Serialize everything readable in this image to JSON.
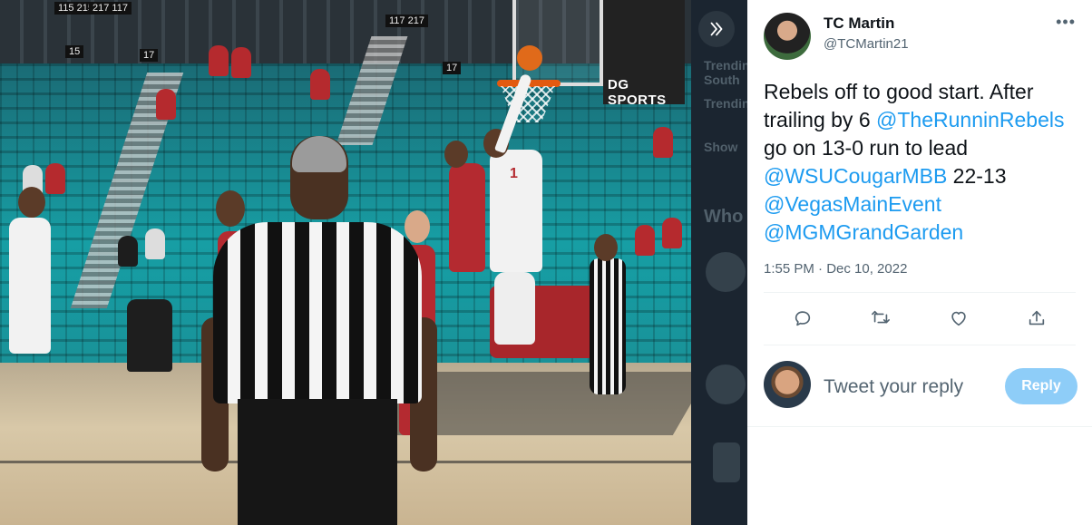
{
  "photo": {
    "section_labels": [
      "115 215",
      "217 117",
      "117 217",
      "15",
      "17",
      "17"
    ],
    "sponsor_text": "DG SPORTS",
    "jersey_number": "1"
  },
  "nav_strip": {
    "expand_icon": "chevrons-right-icon",
    "ghost_trending": "Trendin",
    "ghost_south": "South",
    "ghost_trending2": "Trendin",
    "ghost_show": "Show",
    "ghost_who": "Who"
  },
  "tweet": {
    "author_name": "TC Martin",
    "author_handle": "@TCMartin21",
    "more_icon": "more-horizontal-icon",
    "text_parts": {
      "p1": "Rebels off to good start. After trailing by 6 ",
      "m1": "@TheRunninRebels",
      "p2": " go on 13-0 run to lead ",
      "m2": "@WSUCougarMBB",
      "p3": " 22-13 ",
      "m3": "@VegasMainEvent",
      "p4": " ",
      "m4": "@MGMGrandGarden"
    },
    "timestamp": "1:55 PM · Dec 10, 2022",
    "actions": [
      {
        "name": "reply",
        "icon": "reply-icon"
      },
      {
        "name": "retweet",
        "icon": "retweet-icon"
      },
      {
        "name": "like",
        "icon": "heart-icon"
      },
      {
        "name": "share",
        "icon": "share-icon"
      }
    ]
  },
  "reply_box": {
    "placeholder": "Tweet your reply",
    "button_label": "Reply",
    "button_color": "#8ecdf8"
  },
  "colors": {
    "accent": "#1d9bf0",
    "text_primary": "#0f1419",
    "text_secondary": "#536471",
    "strip_bg": "#1b2530"
  }
}
